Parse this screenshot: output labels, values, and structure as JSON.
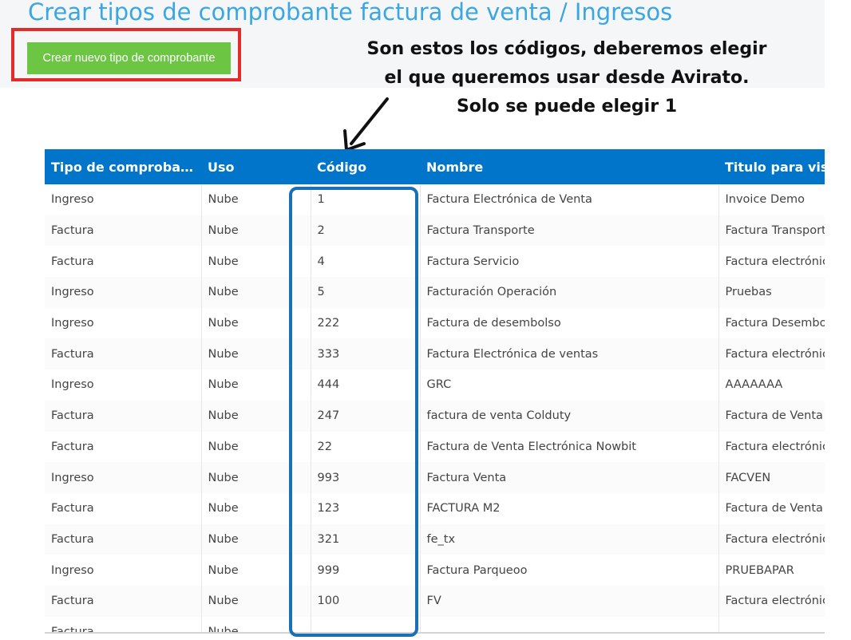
{
  "header": {
    "title": "Crear tipos de comprobante factura de venta / Ingresos",
    "create_button_label": "Crear nuevo tipo de comprobante"
  },
  "annotation": {
    "lines": [
      "Son estos los códigos, deberemos elegir",
      "el que queremos usar desde Avirato.",
      "Solo se puede elegir 1"
    ],
    "arrow_icon": "arrow-down-left-icon"
  },
  "table": {
    "columns": [
      "Tipo de comproba…",
      "Uso",
      "Código",
      "Nombre",
      "Titulo para visualizar"
    ],
    "rows": [
      [
        "Ingreso",
        "Nube",
        "1",
        "Factura Electrónica de Venta",
        "Invoice Demo"
      ],
      [
        "Factura",
        "Nube",
        "2",
        "Factura Transporte",
        "Factura Transporte"
      ],
      [
        "Factura",
        "Nube",
        "4",
        "Factura Servicio",
        "Factura electrónica"
      ],
      [
        "Ingreso",
        "Nube",
        "5",
        "Facturación Operación",
        "Pruebas"
      ],
      [
        "Ingreso",
        "Nube",
        "222",
        "Factura de desembolso",
        "Factura Desembolso"
      ],
      [
        "Factura",
        "Nube",
        "333",
        "Factura Electrónica de ventas",
        "Factura electrónica"
      ],
      [
        "Ingreso",
        "Nube",
        "444",
        "GRC",
        "AAAAAAA"
      ],
      [
        "Factura",
        "Nube",
        "247",
        "factura de venta Colduty",
        "Factura de Venta"
      ],
      [
        "Factura",
        "Nube",
        "22",
        "Factura de Venta Electrónica Nowbit",
        "Factura electrónica"
      ],
      [
        "Ingreso",
        "Nube",
        "993",
        "Factura Venta",
        "FACVEN"
      ],
      [
        "Factura",
        "Nube",
        "123",
        "FACTURA M2",
        "Factura de Venta"
      ],
      [
        "Factura",
        "Nube",
        "321",
        "fe_tx",
        "Factura electrónica"
      ],
      [
        "Ingreso",
        "Nube",
        "999",
        "Factura Parqueoo",
        "PRUEBAPAR"
      ],
      [
        "Factura",
        "Nube",
        "100",
        "FV",
        "Factura electrónica"
      ],
      [
        "Factura",
        "Nube",
        "",
        "",
        ""
      ]
    ]
  },
  "colors": {
    "title": "#3aa7e3",
    "button": "#6cc644",
    "highlight_red": "#e52a2a",
    "table_header": "#0075c9",
    "codigo_outline": "#1b6fb5"
  }
}
